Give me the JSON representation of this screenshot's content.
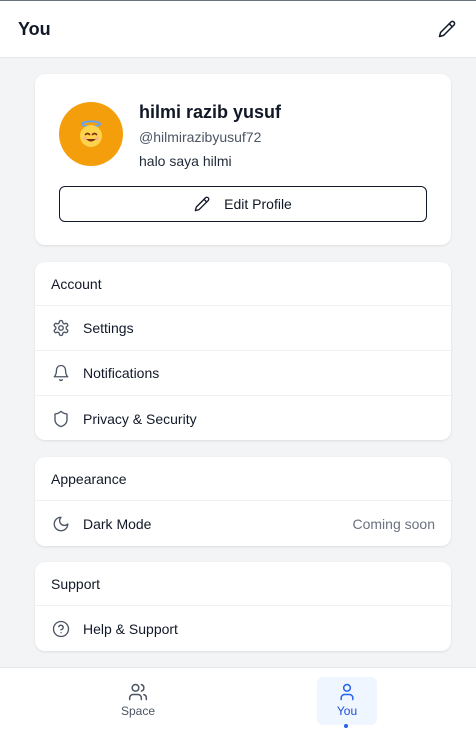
{
  "header": {
    "title": "You"
  },
  "profile": {
    "avatar_emoji": "😇",
    "avatar_color": "#f59e0b",
    "name": "hilmi razib yusuf",
    "handle": "@hilmirazibyusuf72",
    "bio": "halo saya hilmi",
    "edit_label": "Edit Profile"
  },
  "sections": {
    "account": {
      "title": "Account",
      "items": [
        {
          "label": "Settings",
          "icon": "gear-icon"
        },
        {
          "label": "Notifications",
          "icon": "bell-icon"
        },
        {
          "label": "Privacy & Security",
          "icon": "shield-icon"
        }
      ]
    },
    "appearance": {
      "title": "Appearance",
      "items": [
        {
          "label": "Dark Mode",
          "icon": "moon-icon",
          "status": "Coming soon"
        }
      ]
    },
    "support": {
      "title": "Support",
      "items": [
        {
          "label": "Help & Support",
          "icon": "help-circle-icon"
        }
      ]
    }
  },
  "nav": {
    "items": [
      {
        "label": "Space",
        "icon": "users-icon",
        "active": false
      },
      {
        "label": "You",
        "icon": "user-icon",
        "active": true
      }
    ],
    "accent": "#2563eb"
  }
}
